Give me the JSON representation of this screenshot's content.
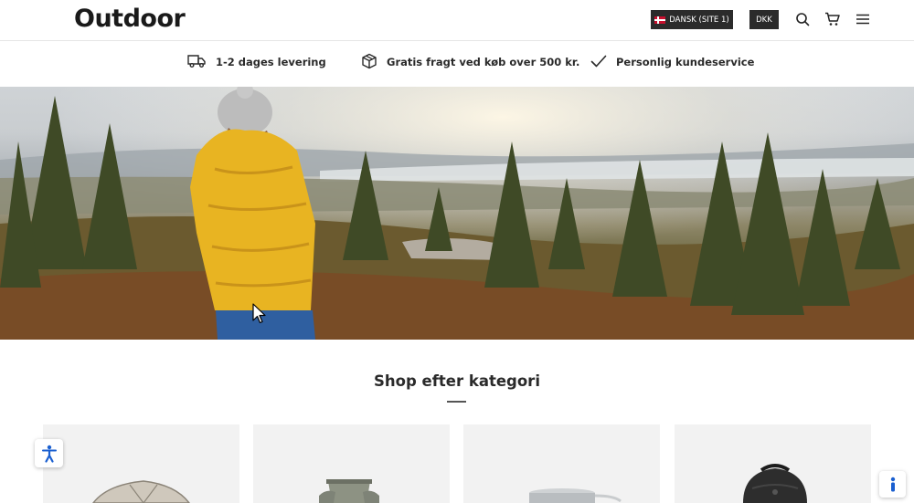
{
  "header": {
    "logo": "Outdoor",
    "language_label": "DANSK (SITE 1)",
    "currency_label": "DKK",
    "icons": [
      "search-icon",
      "cart-icon",
      "menu-icon",
      "denmark-flag-icon"
    ]
  },
  "usp": {
    "items": [
      {
        "icon": "truck-icon",
        "label": "1-2 dages levering"
      },
      {
        "icon": "box-icon",
        "label": "Gratis fragt ved køb over 500 kr."
      },
      {
        "icon": "check-icon",
        "label": "Personlig kundeservice"
      }
    ]
  },
  "categories": {
    "title": "Shop efter kategori",
    "items": [
      {
        "icon": "tent-icon"
      },
      {
        "icon": "camping-chair-icon"
      },
      {
        "icon": "cooking-pot-icon"
      },
      {
        "icon": "backpack-icon"
      }
    ]
  },
  "floating": {
    "accessibility_icon": "accessibility-icon",
    "help_icon": "info-icon"
  },
  "colors": {
    "header_buttons": "#2b2b2b",
    "text": "#1e1e1e",
    "card_background": "#f2f2f2",
    "accessibility_blue": "#1a5fd0",
    "jacket_yellow": "#e8b422"
  }
}
